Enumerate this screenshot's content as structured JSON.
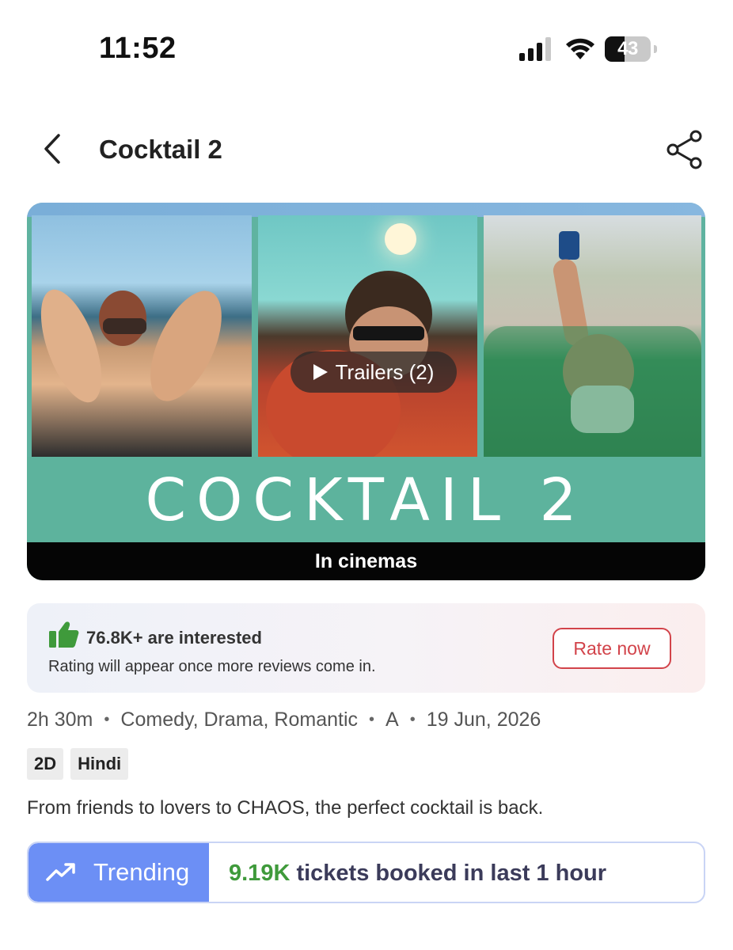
{
  "status_bar": {
    "time": "11:52",
    "battery": "43",
    "battery_level": 0.43
  },
  "header": {
    "title": "Cocktail 2",
    "back_icon": "chevron-left-icon",
    "share_icon": "share-icon"
  },
  "banner": {
    "logo_text": "COCKTAIL 2",
    "trailer_label": "Trailers (2)",
    "footer_label": "In cinemas"
  },
  "interest": {
    "count_text": "76.8K+ are interested",
    "subtext": "Rating will appear once more reviews come in.",
    "rate_button": "Rate now",
    "icon": "thumbs-up-icon",
    "accent": "#d2434a",
    "icon_color": "#3f9a3b"
  },
  "meta": {
    "duration": "2h 30m",
    "genres": "Comedy, Drama, Romantic",
    "certificate": "A",
    "release_date": "19 Jun, 2026"
  },
  "tags": [
    "2D",
    "Hindi"
  ],
  "tagline": "From friends to lovers to CHAOS, the perfect cocktail is back.",
  "trending": {
    "label": "Trending",
    "count": "9.19K",
    "text": " tickets booked in last 1 hour",
    "icon": "trending-up-icon",
    "color": "#6c8ff5"
  }
}
